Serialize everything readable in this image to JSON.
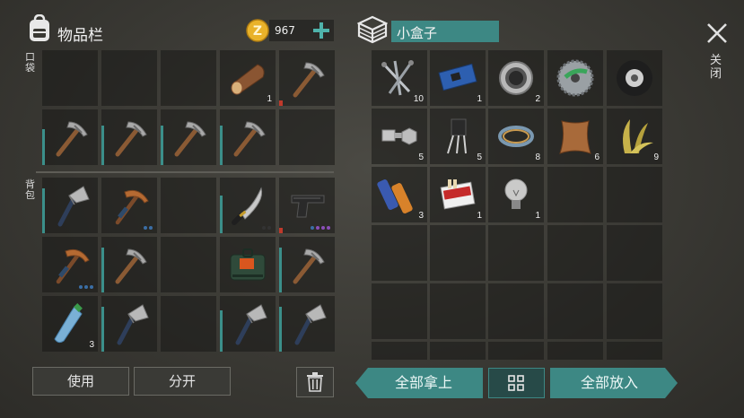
{
  "inventory": {
    "title": "物品栏",
    "coins": "967",
    "pocket_label": "口袋",
    "backpack_label": "背包",
    "pocket_slots": [
      {
        "item": "",
        "count": ""
      },
      {
        "item": "",
        "count": ""
      },
      {
        "item": "",
        "count": ""
      },
      {
        "item": "log",
        "count": "1"
      },
      {
        "item": "pickaxe",
        "count": ""
      },
      {
        "item": "pickaxe",
        "count": ""
      },
      {
        "item": "pickaxe",
        "count": ""
      },
      {
        "item": "pickaxe",
        "count": ""
      },
      {
        "item": "pickaxe",
        "count": ""
      },
      {
        "item": "",
        "count": ""
      }
    ],
    "backpack_slots": [
      {
        "item": "axe",
        "count": ""
      },
      {
        "item": "copper-pickaxe",
        "count": ""
      },
      {
        "item": "",
        "count": ""
      },
      {
        "item": "machete",
        "count": ""
      },
      {
        "item": "pistol",
        "count": ""
      },
      {
        "item": "copper-pickaxe",
        "count": ""
      },
      {
        "item": "pickaxe",
        "count": ""
      },
      {
        "item": "",
        "count": ""
      },
      {
        "item": "supply-crate",
        "count": ""
      },
      {
        "item": "pickaxe",
        "count": ""
      },
      {
        "item": "water-bottle",
        "count": "3"
      },
      {
        "item": "axe",
        "count": ""
      },
      {
        "item": "",
        "count": ""
      },
      {
        "item": "axe",
        "count": ""
      },
      {
        "item": "axe",
        "count": ""
      }
    ],
    "use_label": "使用",
    "split_label": "分开"
  },
  "container": {
    "name": "小盒子",
    "close_label": "关闭",
    "slots": [
      {
        "item": "nails",
        "count": "10"
      },
      {
        "item": "circuit-board",
        "count": "1"
      },
      {
        "item": "bearing",
        "count": "2"
      },
      {
        "item": "saw-blade",
        "count": ""
      },
      {
        "item": "tire",
        "count": ""
      },
      {
        "item": "bolts",
        "count": "5"
      },
      {
        "item": "transistor",
        "count": "5"
      },
      {
        "item": "wire",
        "count": "8"
      },
      {
        "item": "leather",
        "count": "6"
      },
      {
        "item": "plant-fiber",
        "count": "9"
      },
      {
        "item": "batteries",
        "count": "3"
      },
      {
        "item": "cigarettes",
        "count": "1"
      },
      {
        "item": "light-bulb",
        "count": "1"
      }
    ],
    "take_all_label": "全部拿上",
    "put_all_label": "全部放入"
  },
  "colors": {
    "accent": "#3d8884",
    "gold": "#e9b22a"
  }
}
